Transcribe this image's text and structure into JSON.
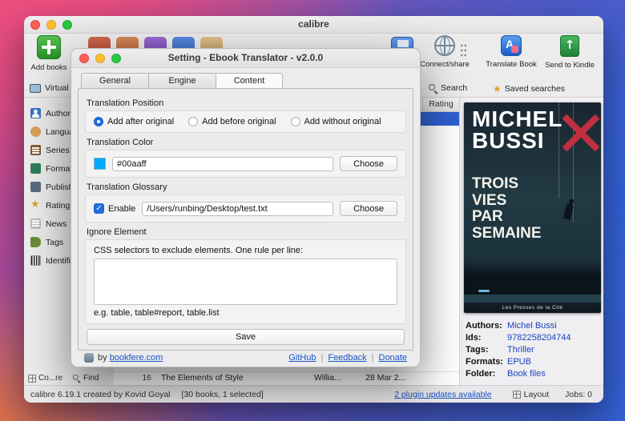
{
  "window": {
    "title": "calibre",
    "toolbar": {
      "add_books": "Add books",
      "connect_share": "Connect/share",
      "translate_book": "Translate Book",
      "send_to_kindle": "Send to Kindle"
    },
    "search_row": {
      "virtual_library": "Virtual library",
      "search": "Search",
      "saved_searches": "Saved searches"
    },
    "sidebar": {
      "items": [
        "Authors",
        "Languages",
        "Series",
        "Formats",
        "Publishers",
        "Rating",
        "News",
        "Tags",
        "Identifiers"
      ]
    },
    "table": {
      "rating_header": "Rating",
      "bottom_row": {
        "index": "16",
        "title": "The Elements of Style",
        "author": "Willia...",
        "date": "28 Mar 2..."
      }
    },
    "left_strip": {
      "cover_grid": "Co...re",
      "find": "Find"
    },
    "book_details": {
      "cover": {
        "author_top": "MICHEL",
        "author_bottom": "BUSSI",
        "title_lines": [
          "TROIS",
          "VIES",
          "PAR",
          "SEMAINE"
        ],
        "publisher": "Les Presses de la Cité"
      },
      "fields": [
        {
          "label": "Authors:",
          "value": "Michel Bussi"
        },
        {
          "label": "Ids:",
          "value": "9782258204744"
        },
        {
          "label": "Tags:",
          "value": "Thriller"
        },
        {
          "label": "Formats:",
          "value": "EPUB"
        },
        {
          "label": "Folder:",
          "value": "Book files"
        }
      ]
    },
    "statusbar": {
      "app_info": "calibre 6.19.1 created by Kovid Goyal",
      "selection": "[30 books, 1 selected]",
      "updates_link": "2 plugin updates available",
      "layout_label": "Layout",
      "jobs_label": "Jobs: 0"
    }
  },
  "dialog": {
    "title": "Setting - Ebook Translator - v2.0.0",
    "tabs": [
      "General",
      "Engine",
      "Content"
    ],
    "active_tab": "Content",
    "position_section": {
      "heading": "Translation Position",
      "options": [
        "Add after original",
        "Add before original",
        "Add without original"
      ],
      "selected_option": "Add after original"
    },
    "color_section": {
      "heading": "Translation Color",
      "value": "#00aaff",
      "swatch_color": "#00aaff",
      "choose_label": "Choose"
    },
    "glossary_section": {
      "heading": "Translation Glossary",
      "enable_label": "Enable",
      "enabled": true,
      "path": "/Users/runbing/Desktop/test.txt",
      "choose_label": "Choose"
    },
    "ignore_section": {
      "heading": "Ignore Element",
      "hint": "CSS selectors to exclude elements. One rule per line:",
      "textarea_value": "",
      "example": "e.g. table, table#report, table.list"
    },
    "save_label": "Save",
    "footer": {
      "by_text": "by",
      "site_link": "bookfere.com",
      "links": [
        "GitHub",
        "Feedback",
        "Donate"
      ]
    }
  },
  "colors": {
    "selected_row": "#3060d0",
    "link_blue": "#1a53c6",
    "translation_swatch": "#00aaff",
    "accent_checkbox": "#1f6fe0"
  }
}
